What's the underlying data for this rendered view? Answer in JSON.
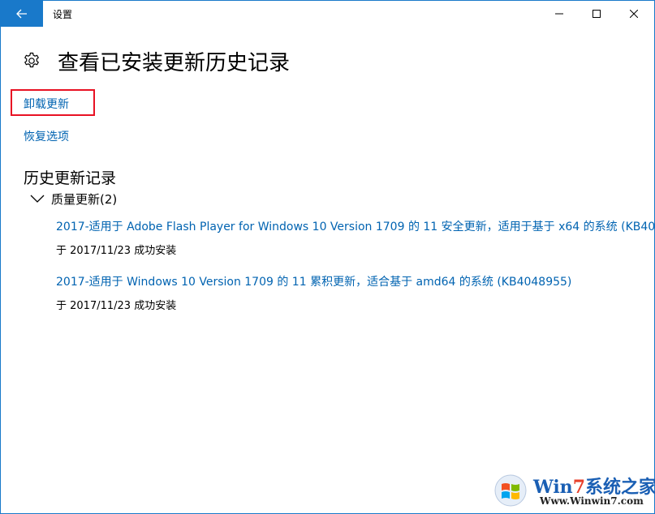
{
  "window": {
    "title": "设置",
    "accent_color": "#1979ca",
    "back_icon": "arrow-left-icon",
    "controls": [
      "minimize-icon",
      "maximize-icon",
      "close-icon"
    ]
  },
  "page": {
    "icon": "gear-icon",
    "title": "查看已安装更新历史记录"
  },
  "links": {
    "uninstall": "卸载更新",
    "recovery": "恢复选项",
    "link_color": "#0063b1",
    "highlight_color": "#e81123"
  },
  "history": {
    "section_title": "历史更新记录",
    "group": {
      "label": "质量更新(2)",
      "icon": "chevron-down-icon",
      "updates": [
        {
          "title": "2017-适用于 Adobe Flash Player for Windows 10 Version 1709 的 11 安全更新，适用于基于 x64 的系统 (KB40",
          "status": "于 2017/11/23 成功安装"
        },
        {
          "title": "2017-适用于 Windows 10 Version 1709 的 11 累积更新，适合基于 amd64 的系统 (KB4048955)",
          "status": "于 2017/11/23 成功安装"
        }
      ]
    }
  },
  "watermark": {
    "brand_prefix": "Win",
    "brand_seven": "7",
    "brand_suffix": "系统之家",
    "url": "Www.Winwin7.com"
  }
}
